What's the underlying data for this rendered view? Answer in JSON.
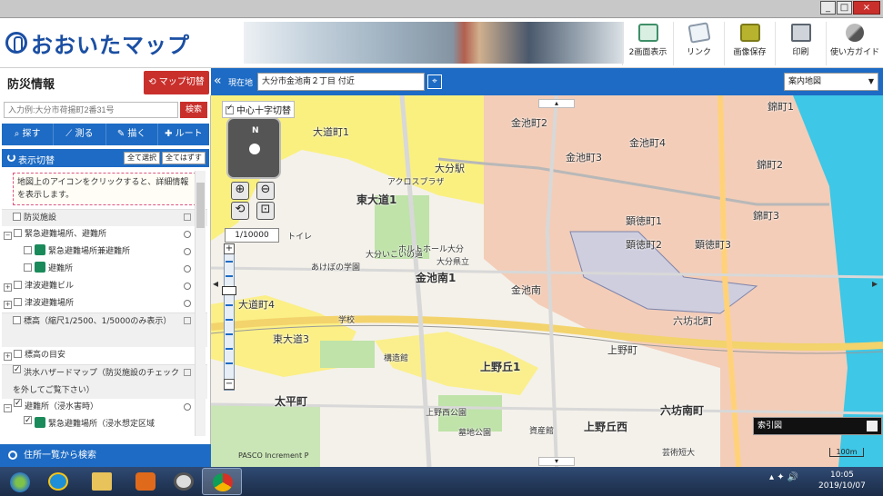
{
  "window": {
    "min": "_",
    "max": "□",
    "close": "×"
  },
  "header": {
    "logo": "おおいたマップ",
    "tools": [
      {
        "label": "2画面表示",
        "icon": "dual-screen-icon"
      },
      {
        "label": "リンク",
        "icon": "link-icon"
      },
      {
        "label": "画像保存",
        "icon": "save-image-icon"
      },
      {
        "label": "印刷",
        "icon": "print-icon"
      },
      {
        "label": "使い方ガイド",
        "icon": "guide-icon"
      }
    ]
  },
  "sidebar": {
    "title": "防災情報",
    "map_switch": "マップ切替",
    "address_placeholder": "入力例:大分市荷揚町2番31号",
    "search": "検索",
    "tabs": [
      "探す",
      "測る",
      "描く",
      "ルート"
    ],
    "panel": {
      "title": "表示切替",
      "select_all": "全て選択",
      "clear_all": "全てはずす",
      "note": "地図上のアイコンをクリックすると、詳細情報を表示します。",
      "rows": [
        {
          "label": "防災施設",
          "type": "header"
        },
        {
          "label": "緊急避難場所、避難所",
          "type": "group"
        },
        {
          "label": "緊急避難場所兼避難所",
          "type": "item"
        },
        {
          "label": "避難所",
          "type": "item"
        },
        {
          "label": "津波避難ビル",
          "type": "group"
        },
        {
          "label": "津波避難場所",
          "type": "group"
        },
        {
          "label": "標高（縮尺1/2500、1/5000のみ表示）",
          "type": "header"
        },
        {
          "label": "標高の目安",
          "type": "group"
        },
        {
          "label": "洪水ハザードマップ（防災施設のチェックを外してご覧下さい）",
          "type": "header"
        },
        {
          "label": "避難所（浸水害時）",
          "type": "group"
        },
        {
          "label": "緊急避難場所（浸水想定区域",
          "type": "item"
        }
      ]
    },
    "address_list": "住所一覧から検索"
  },
  "mapbar": {
    "location_label": "現在地",
    "location": "大分市金池南２丁目 付近",
    "map_type": "案内地図"
  },
  "map": {
    "center_cross": "中心十字切替",
    "scale": "1/10000",
    "index_map": "索引図",
    "attribution": "PASCO  Increment P",
    "scale_bar": "100m",
    "labels": [
      "金池町2",
      "金池町4",
      "金池町3",
      "錦町1",
      "錦町2",
      "錦町3",
      "大道町1",
      "東大道1",
      "大分駅",
      "顕徳町1",
      "顕徳町2",
      "顕徳町3",
      "金池南1",
      "金池南",
      "大道町4",
      "東大道3",
      "上野丘1",
      "上野町",
      "六坊北町",
      "太平町",
      "六坊南町",
      "上野丘西",
      "上野西公園",
      "墓地公園",
      "大分いこいの道",
      "ホルトホール大分",
      "あけぼの学園",
      "学校",
      "構造館",
      "資産館",
      "芸術短大",
      "大分県立",
      "アクロスプラザ",
      "トイレ"
    ]
  },
  "taskbar": {
    "time": "10:05",
    "date": "2019/10/07"
  }
}
